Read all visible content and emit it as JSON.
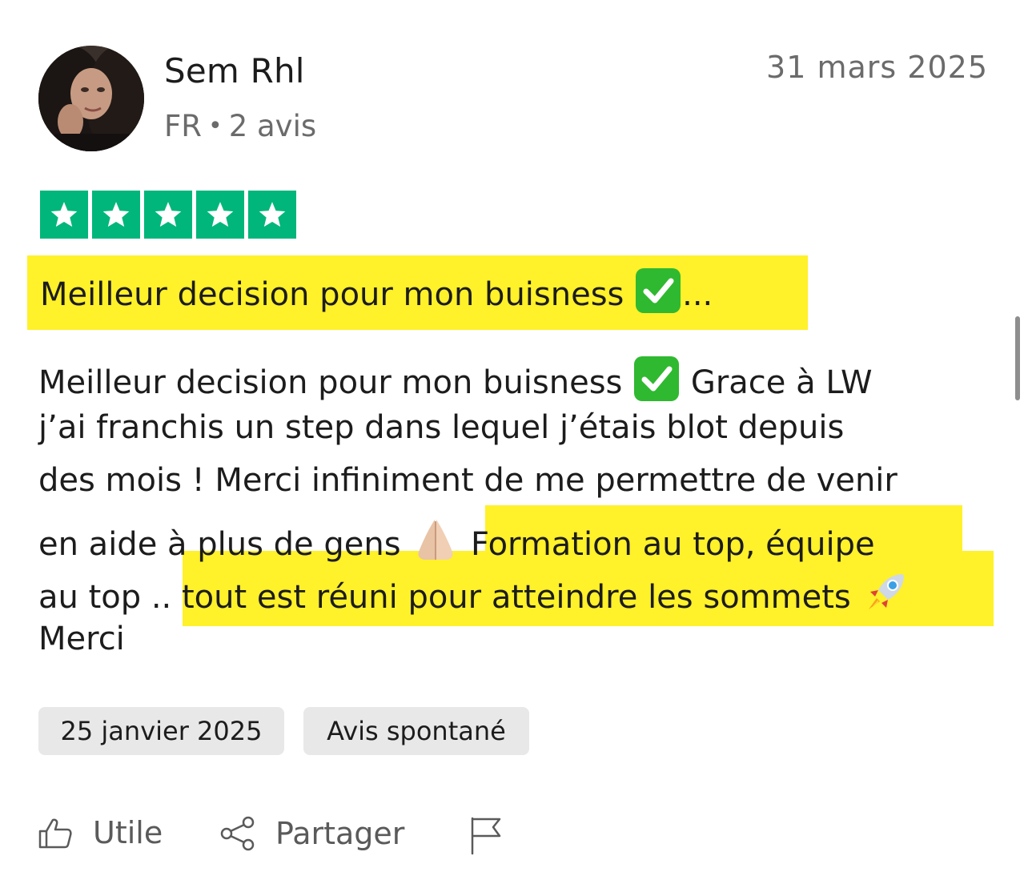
{
  "reviewer": {
    "name": "Sem Rhl",
    "country": "FR",
    "separator": "•",
    "review_count": "2 avis"
  },
  "review": {
    "date": "31 mars 2025",
    "rating": 5,
    "title_text": "Meilleur decision pour mon buisness",
    "title_suffix": "...",
    "body": {
      "line1_a": "Meilleur decision pour mon buisness",
      "line1_b": "Grace à LW",
      "line2": "j’ai franchis un step dans lequel j’étais blot depuis",
      "line3": "des mois ! Merci infiniment de me permettre de venir",
      "line4_a": "en aide à plus de gens",
      "line4_b": "Formation au top, équipe",
      "line5_a": "au top ..",
      "line5_b": "tout est réuni pour atteindre les sommets",
      "line6": "Merci"
    },
    "experience_date": "25 janvier 2025",
    "review_type": "Avis spontané"
  },
  "actions": {
    "useful_label": "Utile",
    "share_label": "Partager"
  },
  "colors": {
    "star_green": "#00b67a",
    "highlight_yellow": "#fff12a",
    "tag_bg": "#e8e8e8"
  },
  "icons": {
    "star": "star-icon",
    "check": "check-mark-emoji",
    "hands": "folded-hands-emoji",
    "rocket": "rocket-emoji",
    "useful": "thumbs-up-icon",
    "share": "share-icon",
    "report": "flag-icon"
  }
}
